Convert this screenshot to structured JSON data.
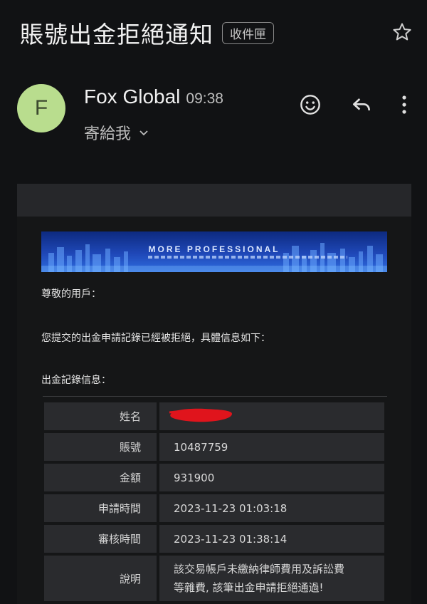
{
  "email": {
    "subject": "賬號出金拒絕通知",
    "folder_label": "收件匣",
    "sender_initial": "F",
    "sender_name": "Fox Global",
    "time": "09:38",
    "recipient": "寄給我"
  },
  "colors": {
    "avatar_bg": "#b9dd8e",
    "redaction": "#e0141c",
    "banner": "#1f48b8"
  },
  "icons": [
    "star-icon",
    "emoji-icon",
    "reply-icon",
    "more-vert-icon",
    "chevron-down-icon"
  ],
  "body": {
    "banner_text": "MORE PROFESSIONAL",
    "greeting": "尊敬的用戶：",
    "intro": "您提交的出金申請記錄已經被拒絕，具體信息如下：",
    "section_title": "出金記錄信息：",
    "table": [
      {
        "label": "姓名",
        "value": ""
      },
      {
        "label": "賬號",
        "value": "10487759"
      },
      {
        "label": "金額",
        "value": "931900"
      },
      {
        "label": "申請時間",
        "value": "2023-11-23 01:03:18"
      },
      {
        "label": "審核時間",
        "value": "2023-11-23 01:38:14"
      },
      {
        "label": "說明",
        "value_line1": "該交易帳戶未繳納律師費用及訴訟費",
        "value_line2": "等雜費, 該筆出金申請拒絕通過!"
      }
    ]
  }
}
